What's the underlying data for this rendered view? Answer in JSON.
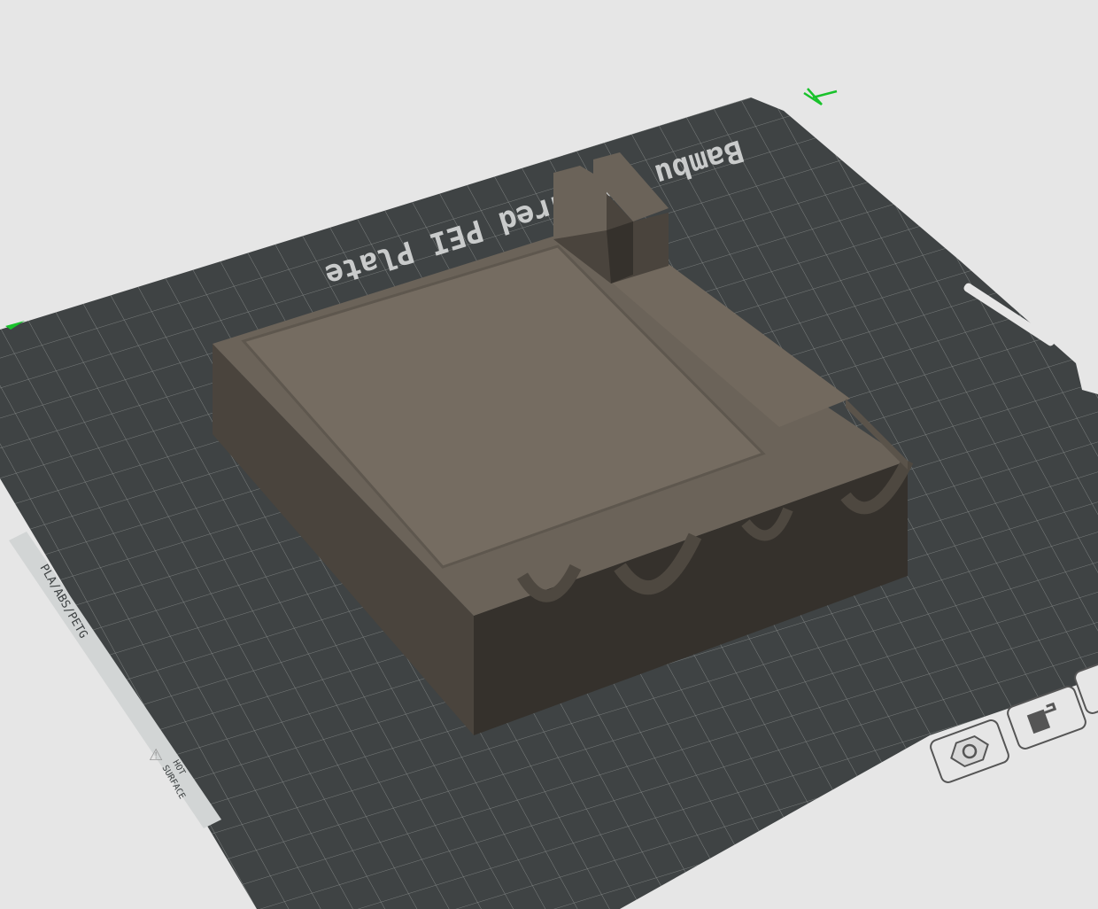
{
  "viewport": {
    "plate_name": "Bambu Textured PEI Plate",
    "strip_material": "PLA/ABS/PETG",
    "strip_warning_line1": "HOT",
    "strip_warning_line2": "SURFACE"
  },
  "plate_buttons": [
    {
      "name": "plate-settings-button",
      "icon": "hexagon-nut-icon"
    },
    {
      "name": "plate-lock-button",
      "icon": "lock-icon"
    }
  ],
  "colors": {
    "background": "#e6e6e6",
    "plate": "#3f4344",
    "grid": "#8c908e",
    "model_top": "#6b6359",
    "model_front": "#35312c",
    "model_side": "#4a443d",
    "axis_green": "#19c22b"
  }
}
